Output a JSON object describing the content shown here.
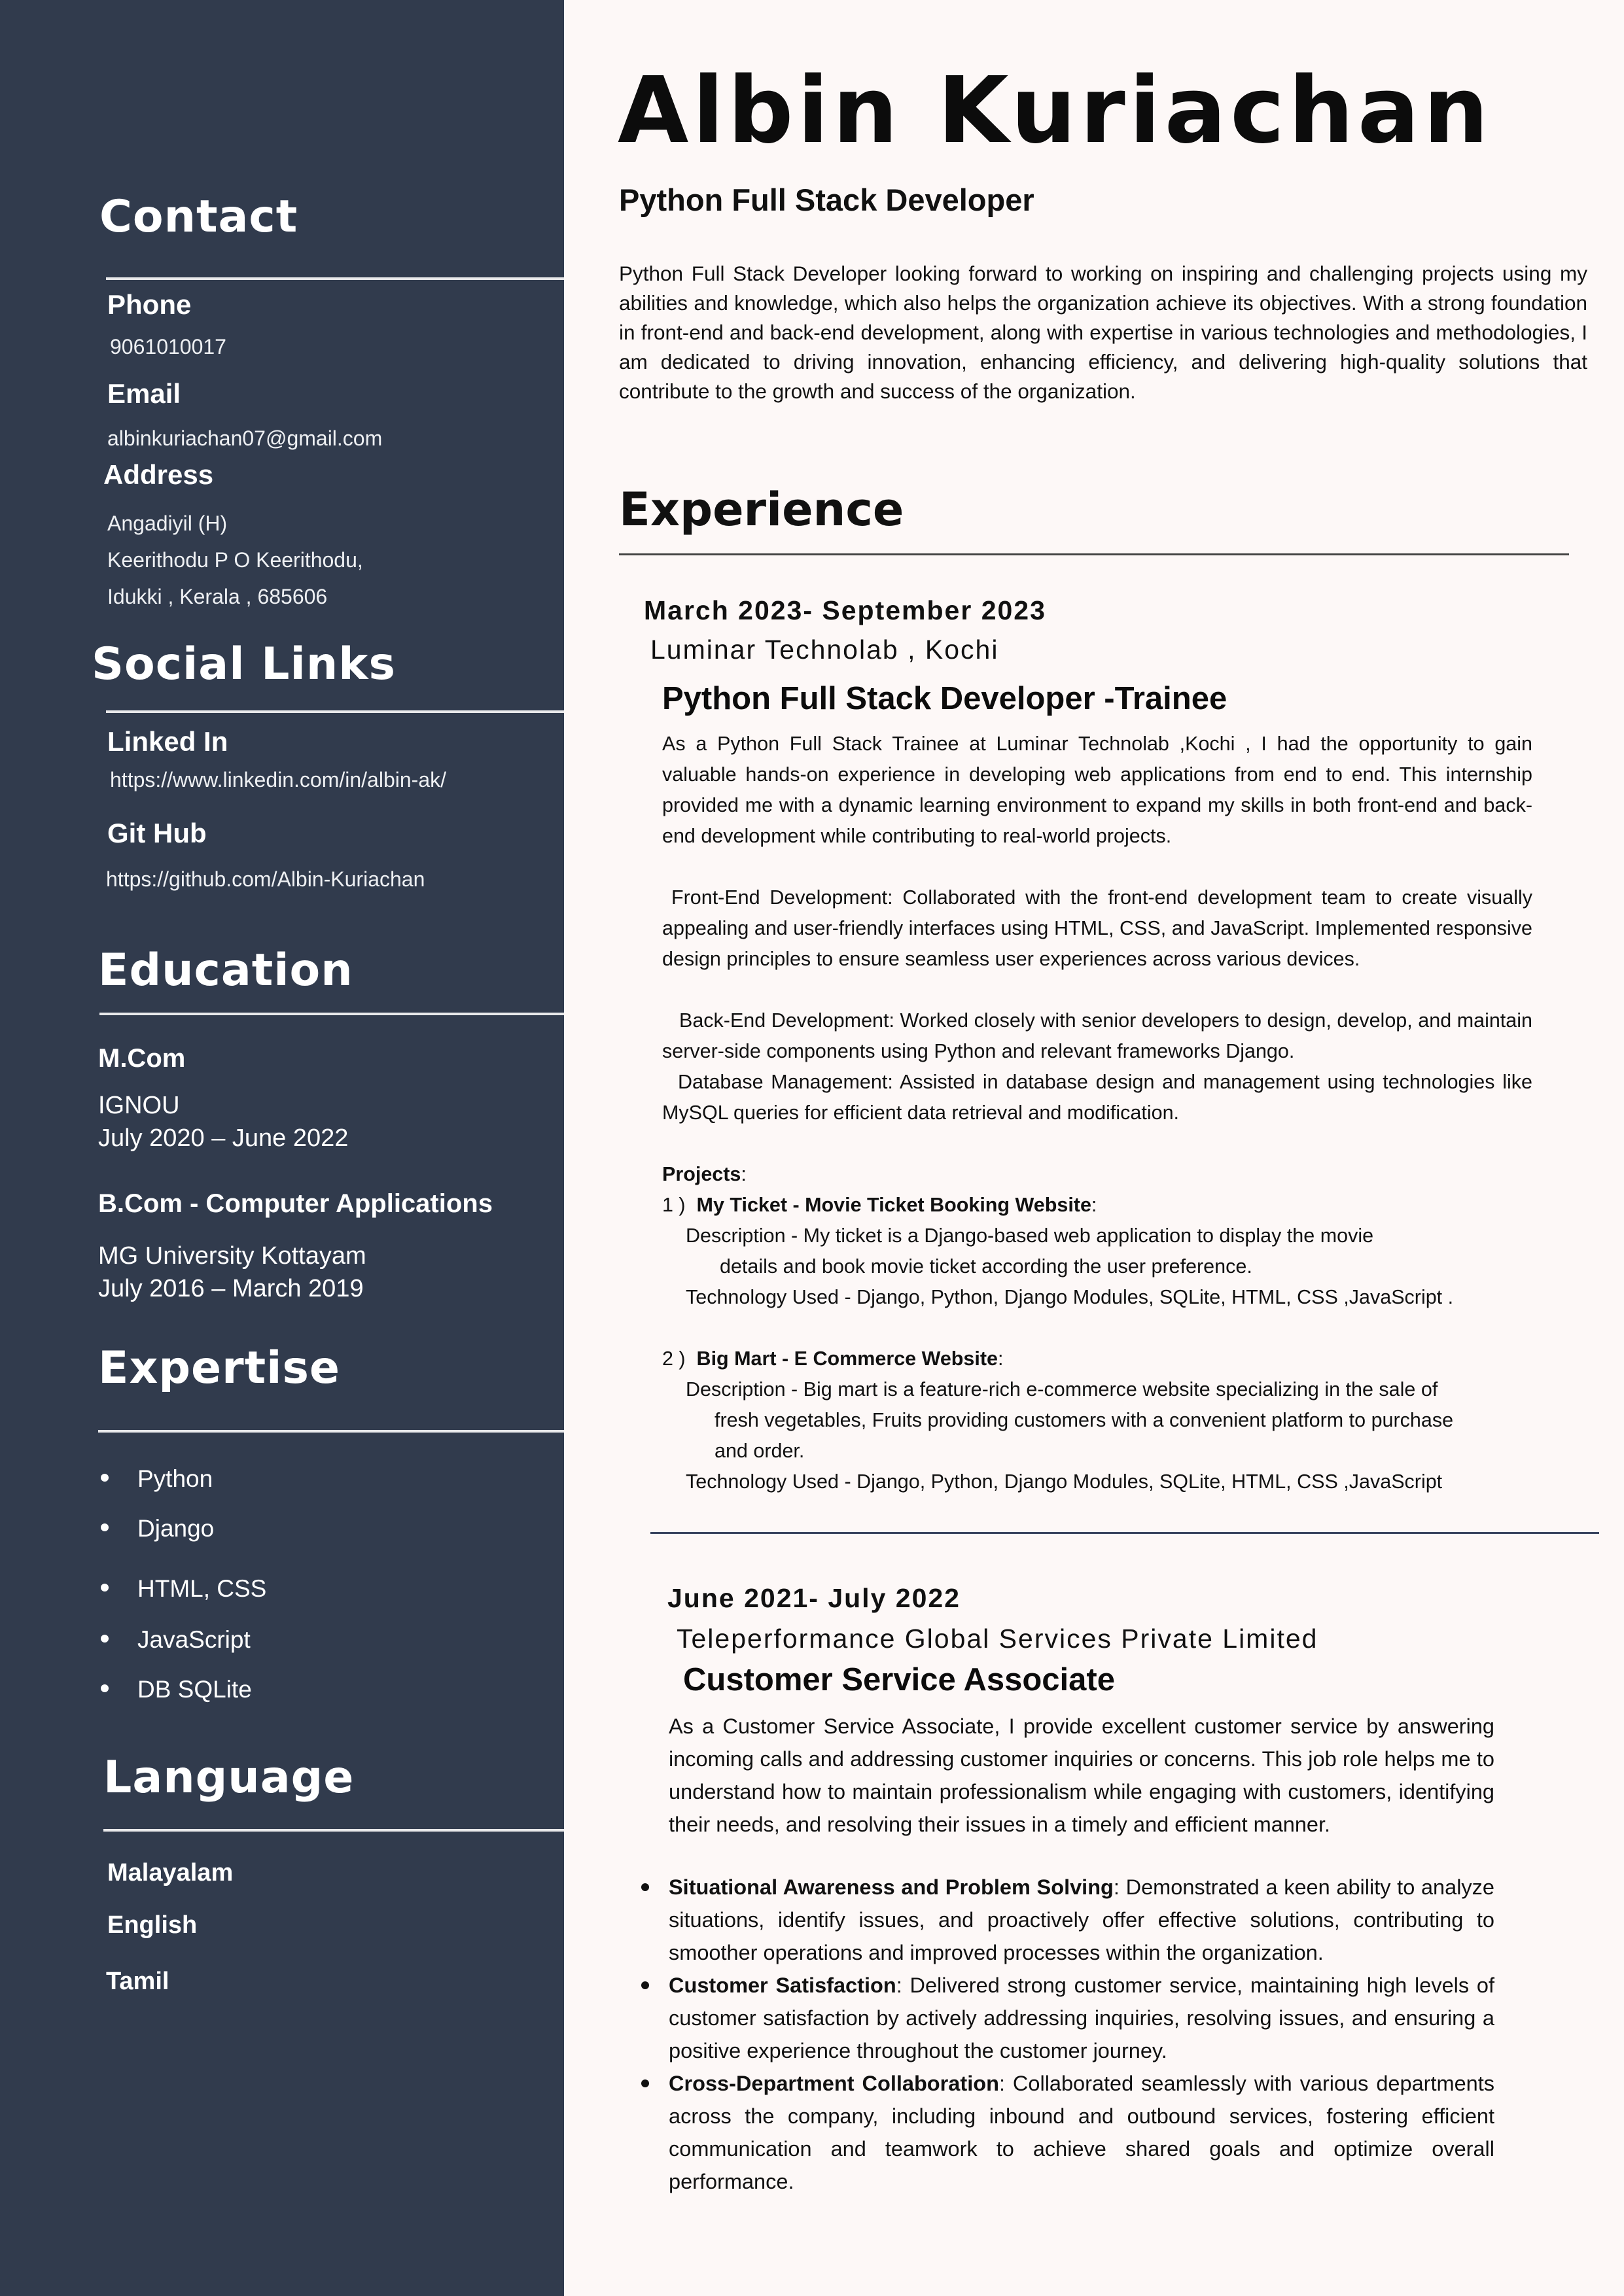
{
  "header": {
    "name": "Albin Kuriachan",
    "role": "Python Full Stack Developer",
    "summary": "Python Full Stack Developer looking forward to working on inspiring and challenging projects using my abilities and knowledge, which also helps the organization achieve its objectives. With a strong foundation in front-end and back-end development, along with expertise in various technologies and methodologies, I am dedicated to driving innovation, enhancing efficiency, and delivering high-quality solutions that contribute to the growth and success of the organization."
  },
  "sidebar": {
    "contact": {
      "heading": "Contact",
      "phone_label": "Phone",
      "phone": "9061010017",
      "email_label": "Email",
      "email": "albinkuriachan07@gmail.com",
      "address_label": "Address",
      "address_lines": [
        "Angadiyil (H)",
        "Keerithodu P O Keerithodu,",
        "Idukki , Kerala ,  685606"
      ]
    },
    "social": {
      "heading": "Social Links",
      "linkedin_label": "Linked In",
      "linkedin": "https://www.linkedin.com/in/albin-ak/",
      "github_label": "Git Hub",
      "github": "https://github.com/Albin-Kuriachan"
    },
    "education": {
      "heading": "Education",
      "items": [
        {
          "degree": "M.Com",
          "school": "IGNOU",
          "period": "July 2020 – June 2022"
        },
        {
          "degree": "B.Com - Computer Applications",
          "school": "MG University Kottayam",
          "period": "July 2016 – March 2019"
        }
      ]
    },
    "expertise": {
      "heading": "Expertise",
      "items": [
        "Python",
        "Django",
        "HTML, CSS",
        "JavaScript",
        "DB SQLite"
      ]
    },
    "language": {
      "heading": "Language",
      "items": [
        "Malayalam",
        "English",
        "Tamil"
      ]
    }
  },
  "experience": {
    "heading": "Experience",
    "job1": {
      "dates": "March 2023- September 2023",
      "company": "Luminar Technolab , Kochi",
      "title": "Python Full Stack Developer -Trainee",
      "intro": "As a Python Full Stack Trainee at Luminar Technolab ,Kochi , I had the opportunity to gain valuable hands-on experience in developing web applications from end to end. This internship provided me with a dynamic learning environment to expand my skills in both front-end and back-end development while contributing to real-world projects.",
      "frontend": "Front-End Development: Collaborated with the front-end development team to create visually appealing and user-friendly interfaces using HTML, CSS, and JavaScript. Implemented responsive design principles to ensure seamless user experiences across various devices.",
      "backend": "Back-End Development: Worked closely with senior developers to design, develop, and maintain server-side components using Python and relevant frameworks  Django.",
      "database": "Database Management: Assisted in database design and management using technologies like MySQL  queries for efficient data retrieval and modification.",
      "projects_label": "Projects",
      "p1_num": "1 )",
      "p1_name": "My Ticket - Movie Ticket Booking  Website",
      "p1_desc1": "Description -  My ticket is a  Django-based web application to display the movie",
      "p1_desc2": "details and book  movie ticket according the user preference.",
      "p1_tech": "Technology Used - Django, Python, Django Modules, SQLite, HTML, CSS ,JavaScript .",
      "p2_num": "2 )",
      "p2_name": "Big Mart - E Commerce Website",
      "p2_desc1": "Description -  Big mart is  a feature-rich e-commerce website specializing in the sale of",
      "p2_desc2": "fresh vegetables, Fruits providing customers with a convenient platform to purchase",
      "p2_desc3": "and order.",
      "p2_tech": "Technology Used - Django, Python, Django Modules, SQLite, HTML, CSS ,JavaScript"
    },
    "job2": {
      "dates": "June 2021- July 2022",
      "company": "Teleperformance Global Services Private Limited",
      "title": "Customer Service Associate",
      "intro": "As a Customer Service Associate, I provide excellent customer service by answering incoming calls and addressing customer inquiries or concerns. This job role helps me to understand how to maintain professionalism while engaging with customers, identifying their needs, and resolving their issues in a timely and efficient manner.",
      "bullets": [
        {
          "bold": "Situational Awareness and Problem Solving",
          "text": ": Demonstrated a keen ability to analyze situations, identify issues, and proactively offer effective solutions, contributing to smoother operations and improved processes within the organization."
        },
        {
          "bold": "Customer Satisfaction",
          "text": ": Delivered strong customer service, maintaining high levels of customer satisfaction by actively addressing inquiries, resolving issues, and ensuring a positive experience throughout the customer journey."
        },
        {
          "bold": "Cross-Department Collaboration",
          "text": ": Collaborated seamlessly with various departments across the company, including inbound and outbound services, fostering efficient communication and teamwork to achieve shared goals and optimize overall performance."
        }
      ]
    }
  }
}
